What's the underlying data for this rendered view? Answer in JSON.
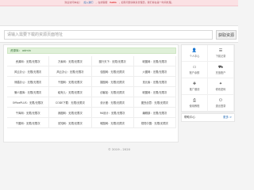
{
  "topbar": {
    "prefix": "欢迎访问本站！",
    "link1": "加入我们",
    "mid": "，在线客服",
    "tag": "hello",
    "notice": "，如有问题请联系管理员，我们将在第一时间处理。"
  },
  "search": {
    "placeholder": "请输入需要下载的资源页面地址",
    "button_label": "获取资源"
  },
  "notice": {
    "label": "资源库：",
    "value": "admin"
  },
  "sites": [
    "资源网：无限/无限次",
    "万素网：无限/无限次",
    "图行天下：无限/无限次",
    "昵图网：无限/无限次",
    "风云办公：无限/无限次",
    "风云办公：无限/无限次",
    "包图网：无限/无限次",
    "六图网：无限/无限次",
    "熊猫办公：无限/无限次",
    "千图网：无限/无限次",
    "摄图网：无限/无限次",
    "觅元素：无限/无限次",
    "懒人图库：无限/无限次",
    "稻壳儿：无限/无限次",
    "创客贴：无限/无限次",
    "昵图网：无限/无限次",
    "OfficePLUS：无限/无限次",
    "CODE下载：无限/无限次",
    "设计团：无限/无限次",
    "图虫创意：无限/无限次",
    "千库网：无限/无限次",
    "我图网：无限/无限次",
    "90设计：无限/无限次",
    "编辑部：无限/无限次",
    "千图网：无限/无限次",
    "觅知网：无限/无限次",
    "昵图网：无限/无限次",
    "视觉中国：无限/无限次"
  ],
  "actions": [
    {
      "icon": "user-icon",
      "glyph": "👤",
      "label": "个人中心"
    },
    {
      "icon": "list-icon",
      "glyph": "☰",
      "label": "下载记录"
    },
    {
      "icon": "card-icon",
      "glyph": "▭",
      "label": "账户余额"
    },
    {
      "icon": "cart-icon",
      "glyph": "⛟",
      "label": "充值账户"
    },
    {
      "icon": "gift-icon",
      "glyph": "✚",
      "label": "推广赚钱"
    },
    {
      "icon": "key-icon",
      "glyph": "✦",
      "label": "修改密码"
    },
    {
      "icon": "doc-icon",
      "glyph": "⎙",
      "label": "使用教程"
    },
    {
      "icon": "power-icon",
      "glyph": "⏻",
      "label": "退出登录"
    }
  ],
  "help": {
    "title": "帮助中心",
    "more": "更多 >"
  },
  "footer": {
    "text": "© 2019 - 2020"
  }
}
